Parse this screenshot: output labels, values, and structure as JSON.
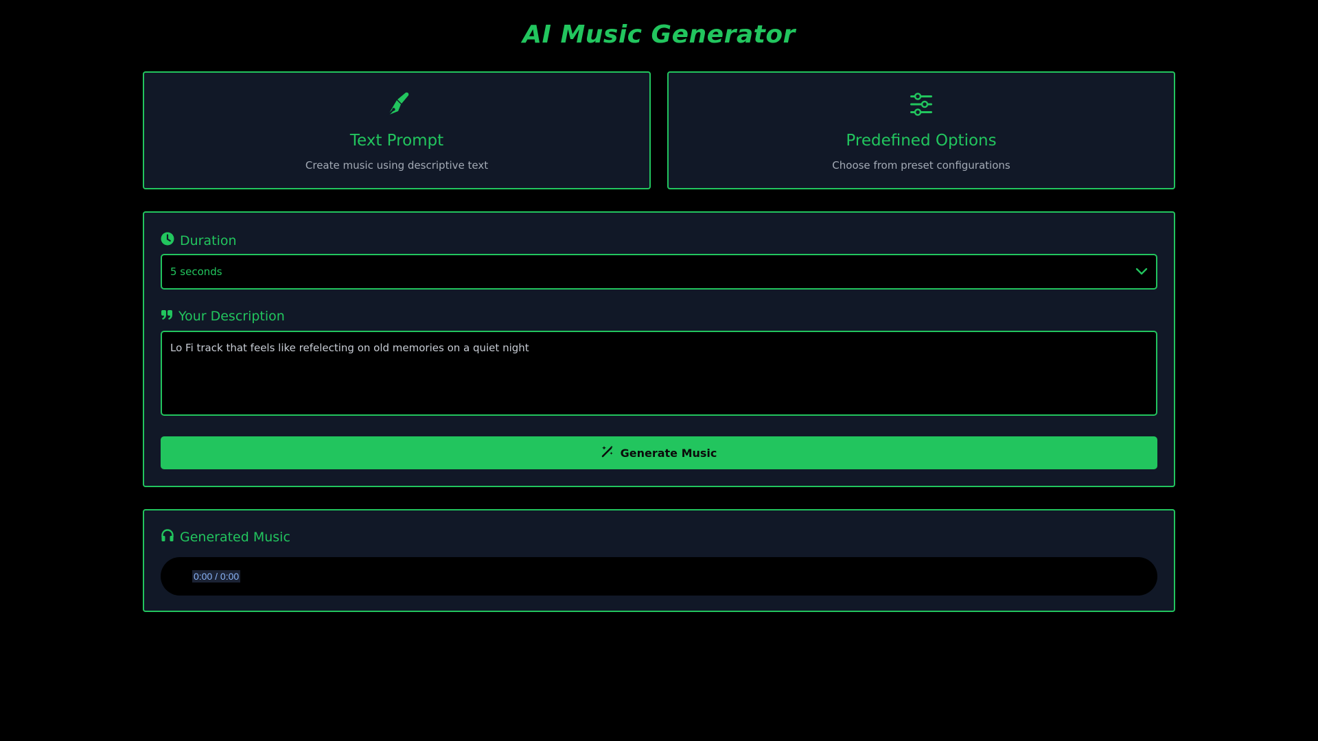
{
  "page": {
    "title": "AI Music Generator"
  },
  "modes": [
    {
      "label": "Text Prompt",
      "description": "Create music using descriptive text",
      "icon": "pen-nib-icon"
    },
    {
      "label": "Predefined Options",
      "description": "Choose from preset configurations",
      "icon": "sliders-icon"
    }
  ],
  "form": {
    "duration_label": "Duration",
    "duration_value": "5 seconds",
    "description_label": "Your Description",
    "description_value": "Lo Fi track that feels like refelecting on old memories on a quiet night",
    "generate_label": "Generate Music"
  },
  "player": {
    "heading": "Generated Music",
    "time": "0:00 / 0:00"
  },
  "colors": {
    "accent": "#22c55e",
    "panel": "#111827",
    "background": "#000000"
  }
}
